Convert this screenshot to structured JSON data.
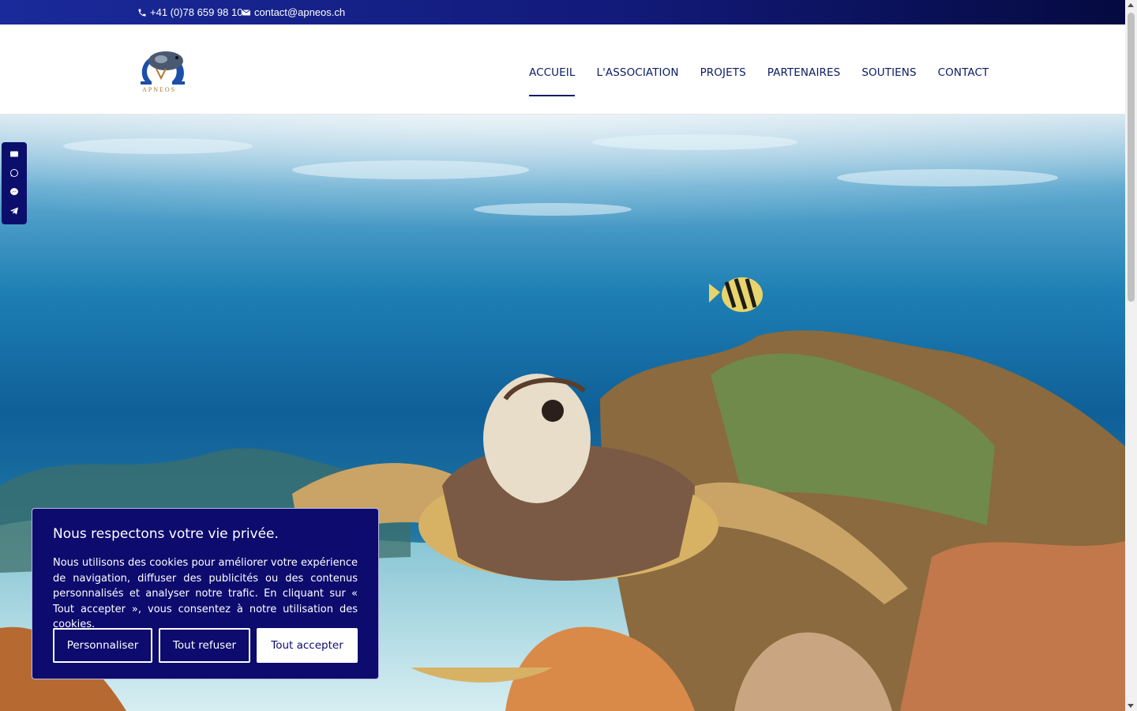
{
  "topbar": {
    "phone": "+41 (0)78 659 98 10",
    "email": "contact@apneos.ch",
    "icons": {
      "phone": "phone-icon",
      "email": "envelope-icon"
    }
  },
  "header": {
    "logo_text": "APNEOS",
    "nav": [
      {
        "label": "ACCUEIL",
        "active": true
      },
      {
        "label": "L'ASSOCIATION",
        "active": false
      },
      {
        "label": "PROJETS",
        "active": false
      },
      {
        "label": "PARTENAIRES",
        "active": false
      },
      {
        "label": "SOUTIENS",
        "active": false
      },
      {
        "label": "CONTACT",
        "active": false
      }
    ]
  },
  "social_bar": {
    "icons": [
      "envelope-icon",
      "whatsapp-icon",
      "messenger-icon",
      "telegram-icon"
    ]
  },
  "cookie_banner": {
    "title": "Nous respectons votre vie privée.",
    "text": "Nous utilisons des cookies pour améliorer votre expérience de navigation, diffuser des publicités ou des contenus personnalisés et analyser notre trafic. En cliquant sur « Tout accepter », vous consentez à notre utilisation des cookies.",
    "buttons": {
      "customize": "Personnaliser",
      "reject": "Tout refuser",
      "accept": "Tout accepter"
    }
  },
  "colors": {
    "brand_navy": "#0b1c63",
    "banner_bg": "#0d0b6e",
    "topbar_start": "#1a2a9a",
    "topbar_end": "#050a40"
  }
}
